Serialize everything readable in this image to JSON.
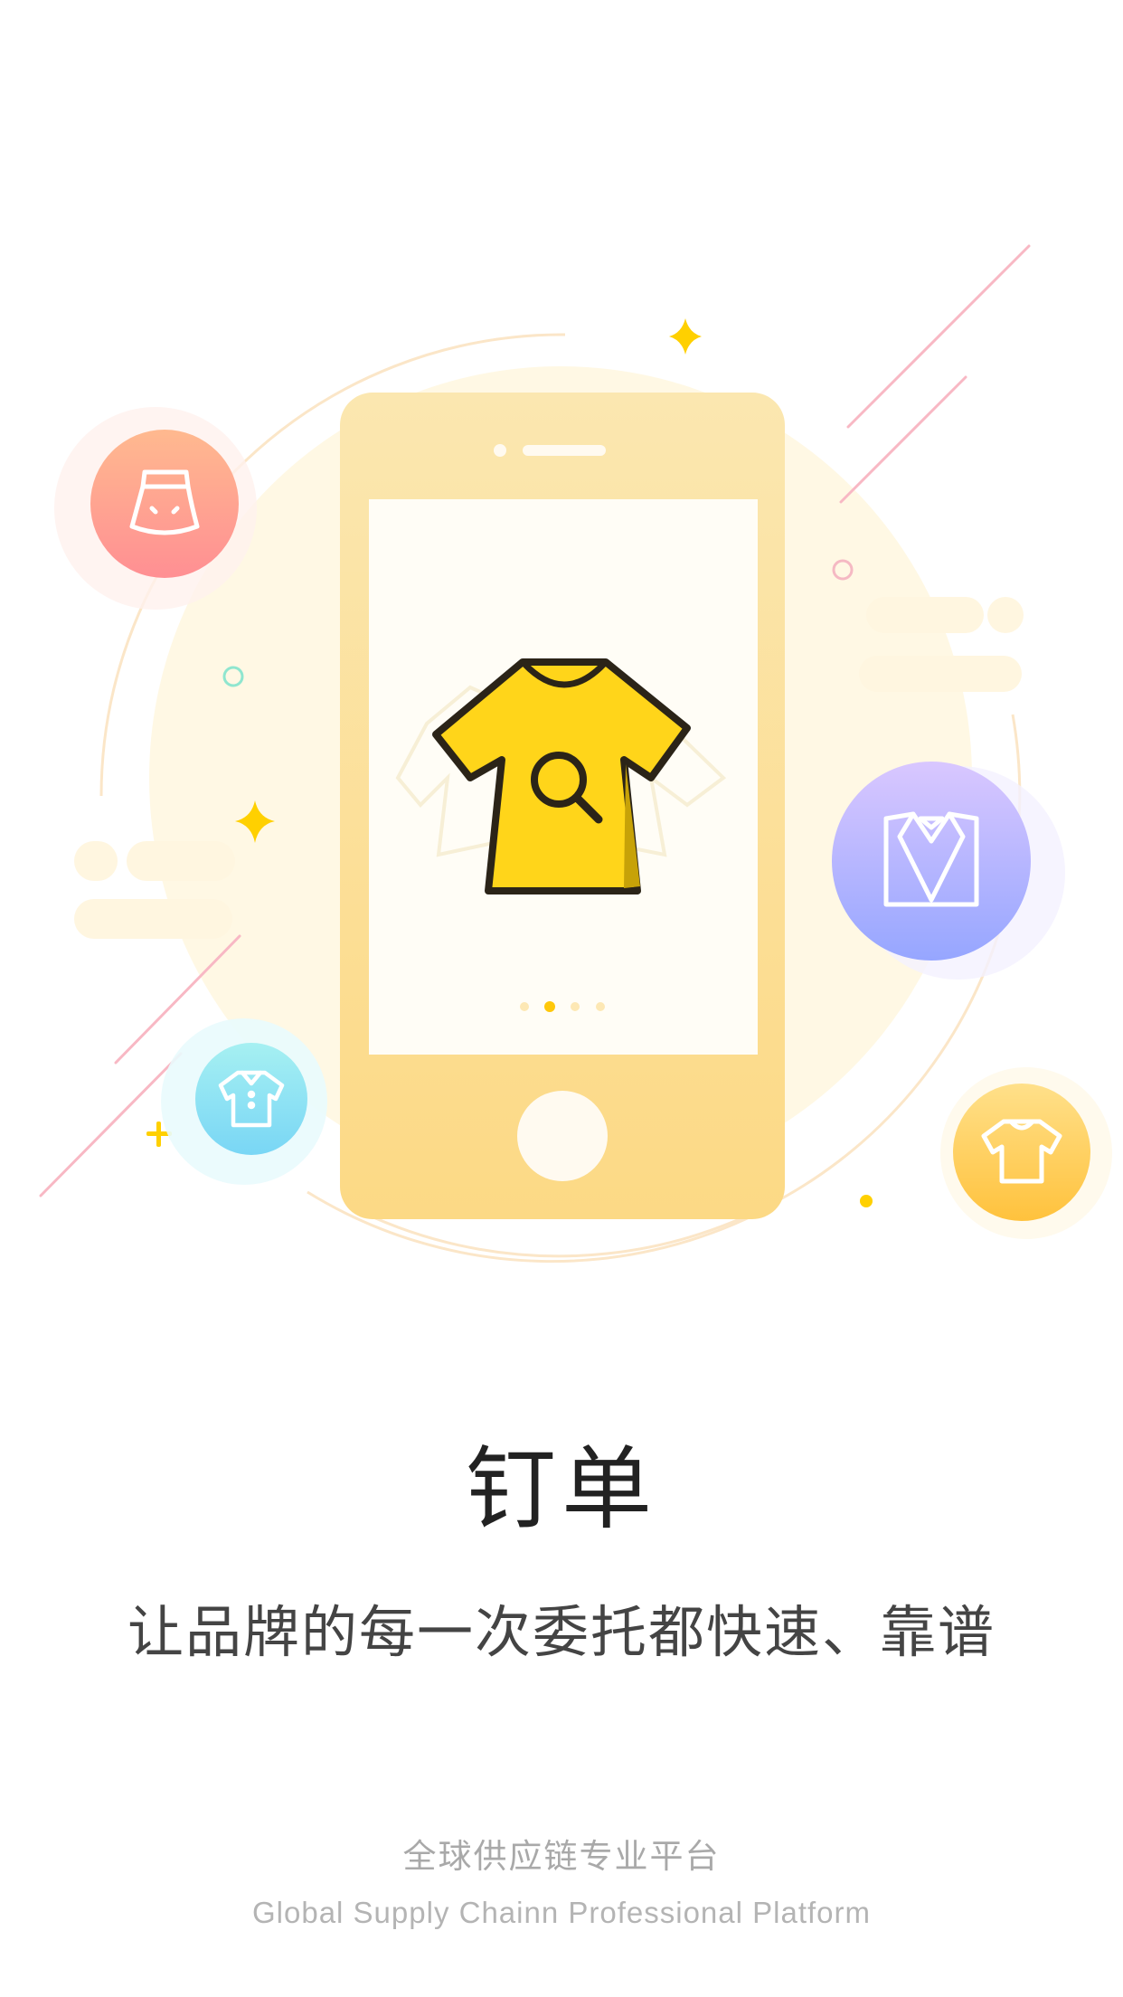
{
  "main": {
    "title": "钉单",
    "subtitle": "让品牌的每一次委托都快速、靠谱"
  },
  "footer": {
    "slogan_cn": "全球供应链专业平台",
    "slogan_en": "Global Supply Chainn Professional Platform"
  },
  "illustration": {
    "center_icon": "tshirt-search-icon",
    "category_icons": [
      "skirt-icon",
      "suit-icon",
      "shirt-icon",
      "tshirt-icon"
    ],
    "carousel": {
      "total_dots": 4,
      "active_dot": 2
    },
    "colors": {
      "phone": "#fcd985",
      "screen": "#fffdf6",
      "tshirt": "#ffd51a",
      "skirt_bubble": "#ff9a8a",
      "suit_bubble": "#a9a6ff",
      "shirt_bubble": "#8ee4f5",
      "tshirt_bubble": "#ffc94f",
      "accent_line": "#f8b8c4",
      "sparkle": "#ffd000"
    }
  }
}
